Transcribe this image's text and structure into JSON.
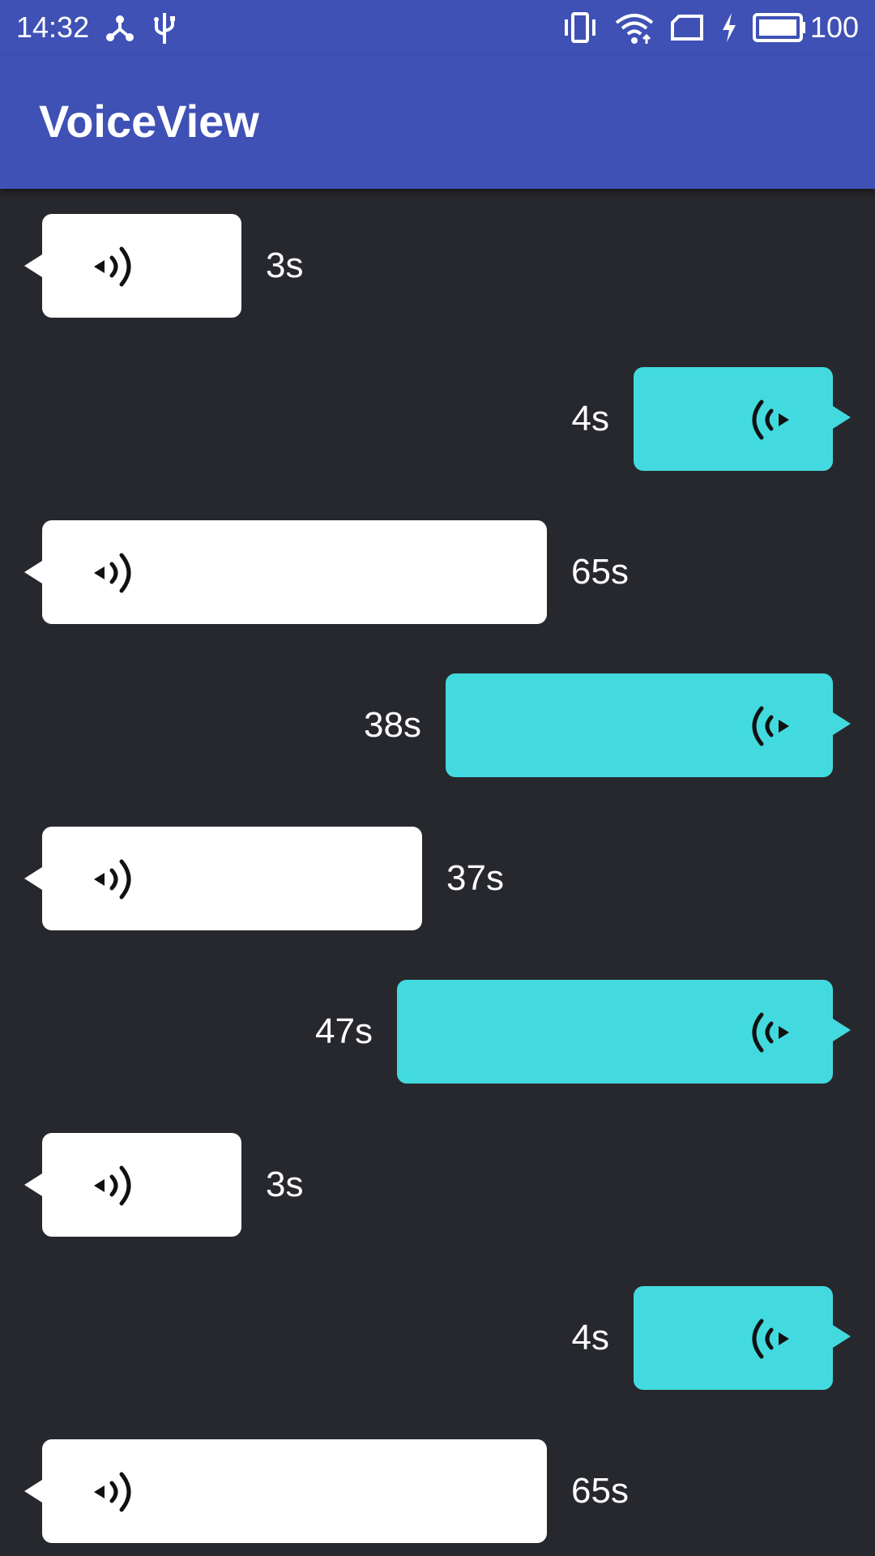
{
  "status_bar": {
    "time": "14:32",
    "battery_level": "100",
    "icons": [
      "share-icon",
      "usb-icon",
      "vibrate-icon",
      "wifi-icon",
      "sim-card-icon",
      "charging-icon",
      "battery-icon"
    ]
  },
  "app_bar": {
    "title": "VoiceView"
  },
  "colors": {
    "primary": "#3f51b5",
    "background": "#27282d",
    "incoming_bubble": "#ffffff",
    "outgoing_bubble": "#43dadf"
  },
  "messages": [
    {
      "side": "left",
      "duration": "3s",
      "icon": "speaker-wave-icon"
    },
    {
      "side": "right",
      "duration": "4s",
      "icon": "speaker-wave-icon"
    },
    {
      "side": "left",
      "duration": "65s",
      "icon": "speaker-wave-icon"
    },
    {
      "side": "right",
      "duration": "38s",
      "icon": "speaker-wave-icon"
    },
    {
      "side": "left",
      "duration": "37s",
      "icon": "speaker-wave-icon"
    },
    {
      "side": "right",
      "duration": "47s",
      "icon": "speaker-wave-icon"
    },
    {
      "side": "left",
      "duration": "3s",
      "icon": "speaker-wave-icon"
    },
    {
      "side": "right",
      "duration": "4s",
      "icon": "speaker-wave-icon"
    },
    {
      "side": "left",
      "duration": "65s",
      "icon": "speaker-wave-icon"
    }
  ]
}
